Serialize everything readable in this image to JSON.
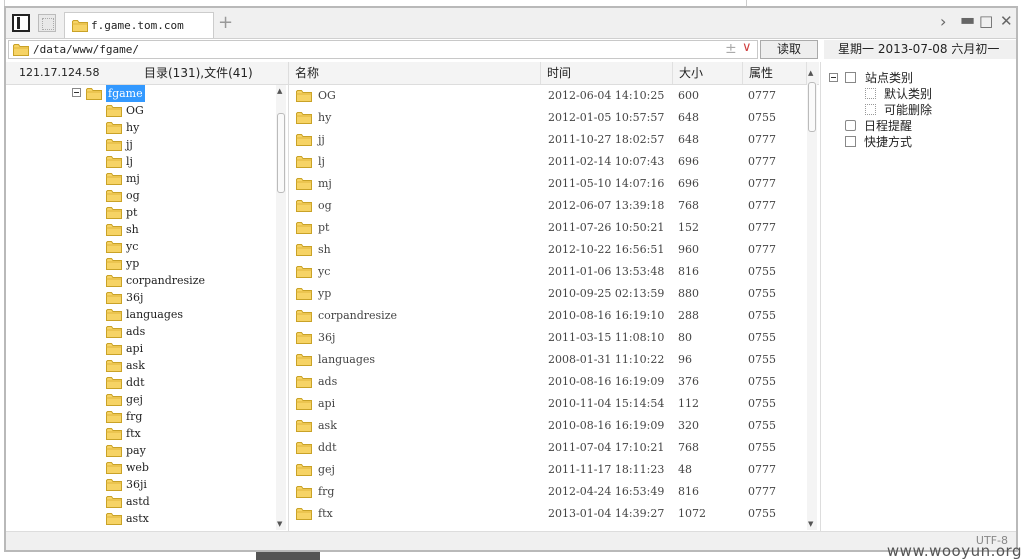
{
  "tab": {
    "title": "f.game.tom.com"
  },
  "address": {
    "path": "/data/www/fgame/",
    "read_button": "读取"
  },
  "date_label": "星期一  2013-07-08  六月初一",
  "left": {
    "host": "121.17.124.58",
    "counts": "目录(131),文件(41)"
  },
  "tree": {
    "root": "fgame",
    "children": [
      "OG",
      "hy",
      "jj",
      "lj",
      "mj",
      "og",
      "pt",
      "sh",
      "yc",
      "yp",
      "corpandresize",
      "36j",
      "languages",
      "ads",
      "api",
      "ask",
      "ddt",
      "gej",
      "frg",
      "ftx",
      "pay",
      "web",
      "36ji",
      "astd",
      "astx"
    ]
  },
  "columns": {
    "name": "名称",
    "time": "时间",
    "size": "大小",
    "attr": "属性"
  },
  "files": [
    {
      "name": "OG",
      "time": "2012-06-04 14:10:25",
      "size": "600",
      "attr": "0777"
    },
    {
      "name": "hy",
      "time": "2012-01-05 10:57:57",
      "size": "648",
      "attr": "0755"
    },
    {
      "name": "jj",
      "time": "2011-10-27 18:02:57",
      "size": "648",
      "attr": "0777"
    },
    {
      "name": "lj",
      "time": "2011-02-14 10:07:43",
      "size": "696",
      "attr": "0777"
    },
    {
      "name": "mj",
      "time": "2011-05-10 14:07:16",
      "size": "696",
      "attr": "0777"
    },
    {
      "name": "og",
      "time": "2012-06-07 13:39:18",
      "size": "768",
      "attr": "0777"
    },
    {
      "name": "pt",
      "time": "2011-07-26 10:50:21",
      "size": "152",
      "attr": "0777"
    },
    {
      "name": "sh",
      "time": "2012-10-22 16:56:51",
      "size": "960",
      "attr": "0777"
    },
    {
      "name": "yc",
      "time": "2011-01-06 13:53:48",
      "size": "816",
      "attr": "0755"
    },
    {
      "name": "yp",
      "time": "2010-09-25 02:13:59",
      "size": "880",
      "attr": "0755"
    },
    {
      "name": "corpandresize",
      "time": "2010-08-16 16:19:10",
      "size": "288",
      "attr": "0755"
    },
    {
      "name": "36j",
      "time": "2011-03-15 11:08:10",
      "size": "80",
      "attr": "0755"
    },
    {
      "name": "languages",
      "time": "2008-01-31 11:10:22",
      "size": "96",
      "attr": "0755"
    },
    {
      "name": "ads",
      "time": "2010-08-16 16:19:09",
      "size": "376",
      "attr": "0755"
    },
    {
      "name": "api",
      "time": "2010-11-04 15:14:54",
      "size": "112",
      "attr": "0755"
    },
    {
      "name": "ask",
      "time": "2010-08-16 16:19:09",
      "size": "320",
      "attr": "0755"
    },
    {
      "name": "ddt",
      "time": "2011-07-04 17:10:21",
      "size": "768",
      "attr": "0755"
    },
    {
      "name": "gej",
      "time": "2011-11-17 18:11:23",
      "size": "48",
      "attr": "0777"
    },
    {
      "name": "frg",
      "time": "2012-04-24 16:53:49",
      "size": "816",
      "attr": "0777"
    },
    {
      "name": "ftx",
      "time": "2013-01-04 14:39:27",
      "size": "1072",
      "attr": "0755"
    }
  ],
  "right": {
    "site_category": "站点类别",
    "default_category": "默认类别",
    "maybe_delete": "可能删除",
    "schedule": "日程提醒",
    "shortcut": "快捷方式"
  },
  "status": {
    "encoding": "UTF-8"
  },
  "watermark": "www.wooyun.org",
  "icons": {
    "folder": "folder-icon",
    "accent": "#3399ff",
    "folder_color": "#f2c744"
  }
}
